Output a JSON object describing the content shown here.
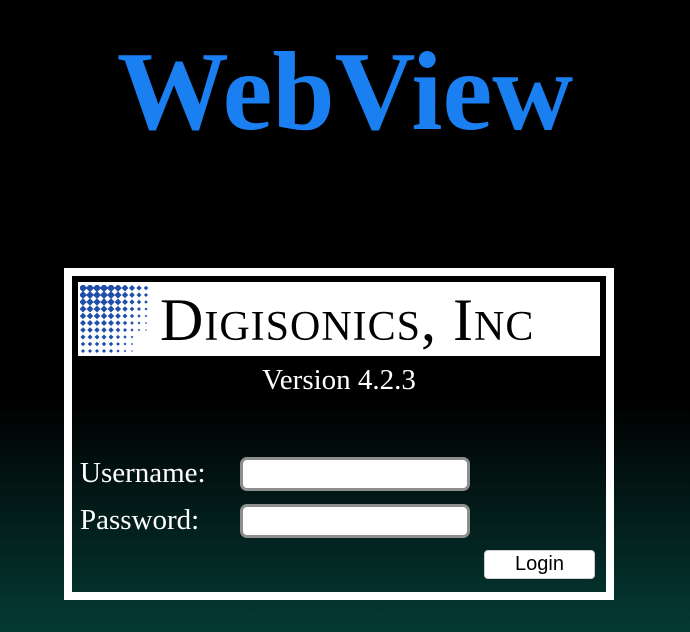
{
  "app": {
    "title": "WebView"
  },
  "logo": {
    "company_name": "Digisonics, Inc",
    "icon": "digisonics-grid-logo-icon"
  },
  "version": {
    "text": "Version 4.2.3"
  },
  "login_form": {
    "username_label": "Username:",
    "username_value": "",
    "password_label": "Password:",
    "password_value": "",
    "login_button_label": "Login"
  },
  "colors": {
    "title_blue": "#1a7ff0",
    "logo_blue": "#1f4fa8",
    "background_top": "#000000",
    "background_bottom": "#053a34",
    "frame": "#ffffff"
  }
}
